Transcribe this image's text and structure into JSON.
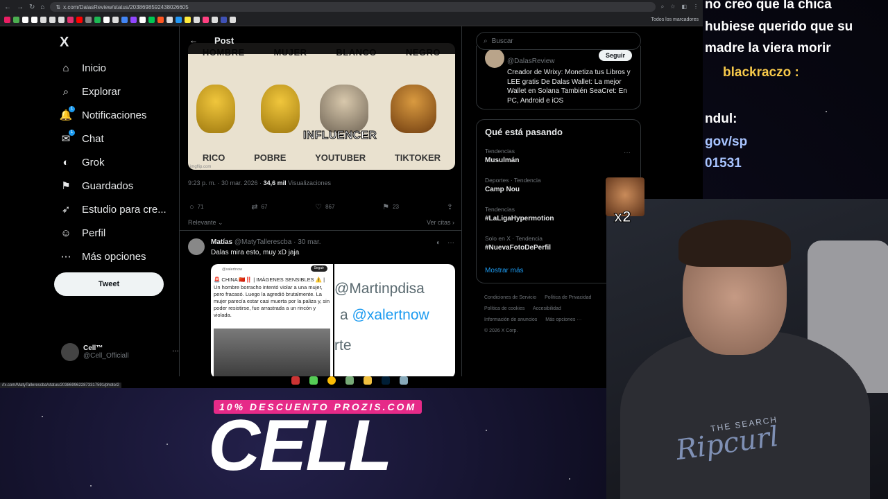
{
  "browser": {
    "url": "x.com/DalasReview/status/2038698592438026605",
    "bookmarks_all": "Todos los marcadores",
    "status_url": "//x.com/MatyTallerescba/status/2038699622873317591/photo/2"
  },
  "nav": {
    "logo": "X",
    "items": [
      {
        "label": "Inicio",
        "icon": "⌂",
        "badge": ""
      },
      {
        "label": "Explorar",
        "icon": "⌕",
        "badge": ""
      },
      {
        "label": "Notificaciones",
        "icon": "🔔",
        "badge": "1"
      },
      {
        "label": "Chat",
        "icon": "✉",
        "badge": "1"
      },
      {
        "label": "Grok",
        "icon": "◐",
        "badge": ""
      },
      {
        "label": "Guardados",
        "icon": "⚑",
        "badge": ""
      },
      {
        "label": "Estudio para cre...",
        "icon": "➶",
        "badge": ""
      },
      {
        "label": "Perfil",
        "icon": "☺",
        "badge": ""
      },
      {
        "label": "Más opciones",
        "icon": "⋯",
        "badge": ""
      }
    ],
    "tweet_button": "Tweet",
    "profile": {
      "name": "Cell™",
      "handle": "@Cell_Officiall",
      "more": "···"
    }
  },
  "post": {
    "header_title": "Post",
    "back": "←",
    "meme": {
      "top_labels": [
        "HOMBRE",
        "MUJER",
        "BLANCO",
        "NEGRO"
      ],
      "bottom_labels": [
        "RICO",
        "POBRE",
        "YOUTUBER",
        "TIKTOKER"
      ],
      "overlay": "INFLUENCER",
      "watermark": "imgflip.com"
    },
    "time": "9:23 p. m. · 30 mar. 2026 ·",
    "views_count": "34,6 mil",
    "views_label": "Visualizaciones",
    "actions": {
      "replies": "71",
      "reposts": "67",
      "likes": "867",
      "bookmarks": "23"
    },
    "sort_label": "Relevante",
    "quotes_label": "Ver citas"
  },
  "reply": {
    "name": "Matías",
    "handle": "@MatyTallerescba · 30 mar.",
    "text": "Dalas mira esto, muy xD jaja",
    "embed": {
      "handle": "@xalertnow",
      "follow": "Seguir",
      "text": "🚨 CHINA 🇨🇳‼️ | IMÁGENES SENSIBLES ⚠️ | Un hombre borracho intentó violar a una mujer, pero fracasó. Luego la agredió brutalmente. La mujer parecía estar casi muerta por la paliza y, sin poder resistirse, fue arrastrada a un rincón y violada.",
      "line1": "@Martinpdisa",
      "line2_prefix": "a ",
      "line2_handle": "@xalertnow",
      "line3": "rte"
    }
  },
  "right": {
    "search_placeholder": "Buscar",
    "bio_handle": "@DalasReview",
    "follow": "Seguir",
    "bio_text": "Creador de Wrixy: Monetiza tus Libros y LEE gratis De Dalas Wallet: La mejor Wallet en Solana También SeaCret: En PC, Android e iOS",
    "trends_title": "Qué está pasando",
    "trends": [
      {
        "context": "Tendencias",
        "name": "Musulmán"
      },
      {
        "context": "Deportes · Tendencia",
        "name": "Camp Nou"
      },
      {
        "context": "Tendencias",
        "name": "#LaLigaHypermotion"
      },
      {
        "context": "Solo en X · Tendencia",
        "name": "#NuevaFotoDePerfil"
      }
    ],
    "show_more": "Mostrar más",
    "footer": [
      "Condiciones de Servicio",
      "Política de Privacidad",
      "Política de cookies",
      "Accesibilidad",
      "Información de anuncios",
      "Más opciones ···",
      "© 2026 X Corp."
    ]
  },
  "stream": {
    "chat_line1": "no creo que la chica",
    "chat_line2": "hubiese querido que su",
    "chat_line3": "madre la viera morir",
    "chat_user": "blackraczo :",
    "chat_line4": "ndul:",
    "chat_line5": "gov/sp",
    "chat_line6": "01531",
    "emote_mult": "x2",
    "promo": "10% DESCUENTO PROZIS.COM",
    "brand": "CELL",
    "shirt_line": "THE SEARCH",
    "shirt_logo": "Ripcurl"
  },
  "colors": {
    "accent": "#1d9bf0",
    "promo": "#e62a88",
    "chat_user": "#f6c84a"
  }
}
